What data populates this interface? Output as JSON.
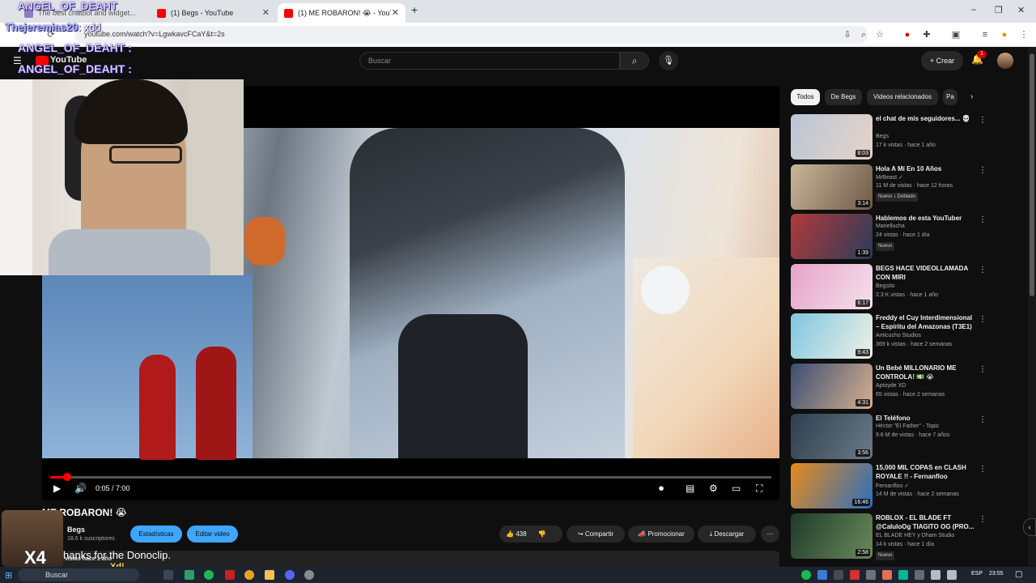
{
  "browser": {
    "tabs": [
      {
        "label": "The best chatbot and widget..."
      },
      {
        "label": "(1) Begs - YouTube"
      },
      {
        "label": "(1) ME ROBARON! 😭 - YouTube"
      }
    ],
    "url": "youtube.com/watch?v=LgwkavcFCaY&t=2s",
    "new_tab": "+",
    "win_min": "–",
    "win_max": "❐",
    "win_close": "✕"
  },
  "youtube": {
    "logo": "YouTube",
    "search_placeholder": "Buscar",
    "create_label": "Crear",
    "notif_count": "1"
  },
  "player": {
    "time": "0:05 / 7:00",
    "progress": 0.012
  },
  "video": {
    "title": "ME ROBARON! 😭",
    "channel": "Begs",
    "subscribers": "18.6 k suscriptores",
    "stats_btn": "Estadísticas",
    "edit_btn": "Editar video",
    "likes": "438",
    "share": "Compartir",
    "promote": "Promocionar",
    "download": "Descargar",
    "desc_meta": "vistas  hace 1 año",
    "donation_text": "hanks for the Donoclip."
  },
  "overlay": {
    "chat": [
      {
        "user": "ANGEL_OF_DEAHT"
      },
      {
        "user": "Thejeremias20",
        "msg": ": xdd"
      },
      {
        "user": "ANGEL_OF_DEAHT :"
      },
      {
        "user": "ANGEL_OF_DEAHT :"
      }
    ],
    "combo": "X4",
    "xd": "Xd!"
  },
  "sidebar": {
    "chips": [
      "Todos",
      "De Begs",
      "Videos relacionados",
      "Pa"
    ],
    "recs": [
      {
        "title": "el chat de mis seguidores... 💀",
        "channel": "Begs",
        "meta": "17 k vistas · hace 1 año",
        "dur": "8:03",
        "badge": "",
        "c1": "#b9c6d6",
        "c2": "#e8d3c8"
      },
      {
        "title": "Hola A Mí En 10 Años",
        "channel": "MrBeast ✓",
        "meta": "11 M de vistas · hace 12 horas",
        "dur": "3:14",
        "badge": "Nuevo  ♪ Doblado",
        "c1": "#c9b79a",
        "c2": "#6e5a48"
      },
      {
        "title": "Hablemos de esta YouTuber",
        "channel": "Mariellucha",
        "meta": "24 vistas · hace 1 día",
        "dur": "1:39",
        "badge": "Nuevo",
        "c1": "#b23a3a",
        "c2": "#2a3c5a"
      },
      {
        "title": "BEGS HACE VIDEOLLAMADA CON MIRI",
        "channel": "Begsito",
        "meta": "2.3 K vistas · hace 1 año",
        "dur": "6:17",
        "badge": "",
        "c1": "#e7a3c9",
        "c2": "#f4e1ea"
      },
      {
        "title": "Freddy el Cuy Interdimensional – Espíritu del Amazonas (T3E1)",
        "channel": "Anticucho Studios",
        "meta": "369 k vistas · hace 2 semanas",
        "dur": "9:43",
        "badge": "",
        "c1": "#7fc6e0",
        "c2": "#f0f0e6"
      },
      {
        "title": "Un Bebé MILLONARIO ME CONTROLA! 💵 😭",
        "channel": "Aptoyde XD",
        "meta": "65 vistas · hace 2 semanas",
        "dur": "4:31",
        "badge": "",
        "c1": "#3b4e73",
        "c2": "#d7b08f"
      },
      {
        "title": "El Teléfono",
        "channel": "Héctor \"El Father\" - Topic",
        "meta": "9.6 M de vistas · hace 7 años",
        "dur": "3:56",
        "badge": "",
        "c1": "#2e3e4e",
        "c2": "#6b7a86"
      },
      {
        "title": "15,000 MIL COPAS en CLASH ROYALE !! - Fernanfloo",
        "channel": "Fernanfloo ✓",
        "meta": "14 M de vistas · hace 2 semanas",
        "dur": "16:46",
        "badge": "",
        "c1": "#e88a1a",
        "c2": "#2b6fbf"
      },
      {
        "title": "ROBLOX - EL BLADE FT @CaluloOg  TIAGITO OG (PRO...",
        "channel": "EL BLADE HEY y Dham Studio",
        "meta": "14 k vistas · hace 1 día",
        "dur": "2:58",
        "badge": "Nuevo",
        "c1": "#1f3a2a",
        "c2": "#6b8a5a"
      }
    ]
  },
  "taskbar": {
    "search": "Buscar",
    "lang": "ESP",
    "time": "23:55"
  },
  "colors": {
    "bg": "#0f0f0f",
    "accent_red": "#ff0000",
    "accent_blue": "#3ea6ff"
  }
}
